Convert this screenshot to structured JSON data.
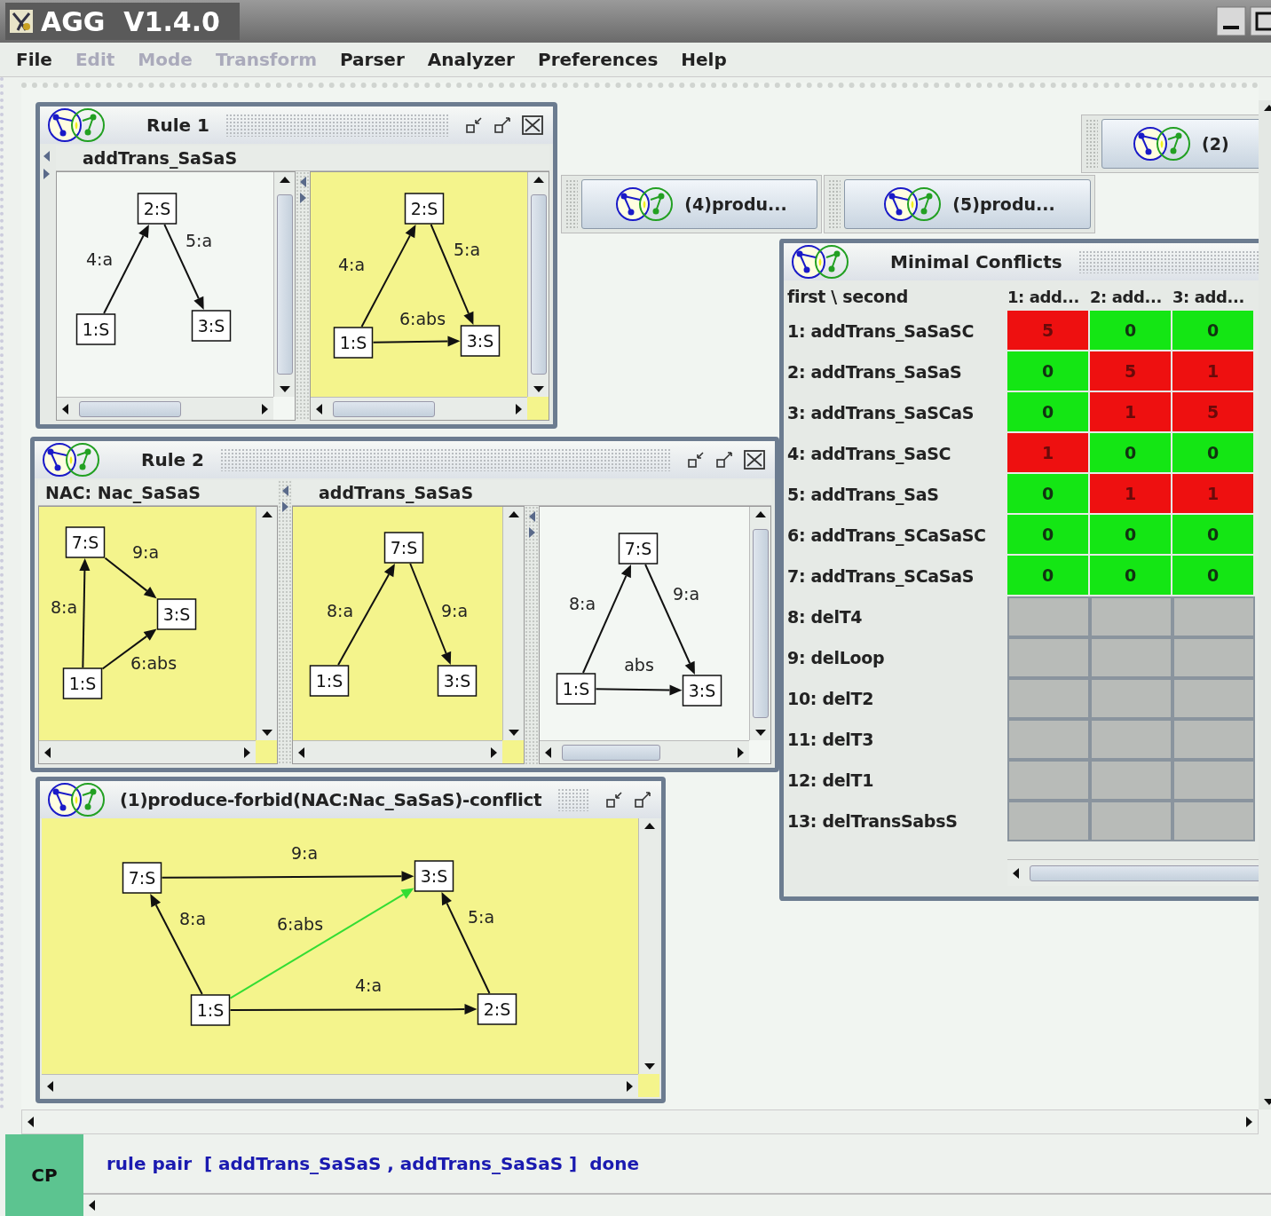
{
  "window": {
    "title": "AGG  V1.4.0"
  },
  "menu": [
    {
      "label": "File",
      "disabled": false
    },
    {
      "label": "Edit",
      "disabled": true
    },
    {
      "label": "Mode",
      "disabled": true
    },
    {
      "label": "Transform",
      "disabled": true
    },
    {
      "label": "Parser",
      "disabled": false
    },
    {
      "label": "Analyzer",
      "disabled": false
    },
    {
      "label": "Preferences",
      "disabled": false
    },
    {
      "label": "Help",
      "disabled": false
    }
  ],
  "iconified_frames": [
    {
      "label": "(2)"
    },
    {
      "label": "(4)produ..."
    },
    {
      "label": "(5)produ..."
    }
  ],
  "rule_frames": [
    {
      "title": "Rule 1",
      "sections": [
        {
          "header": "addTrans_SaSaS",
          "graphs": [
            {
              "selected": false,
              "nodes": [
                "2:S",
                "1:S",
                "3:S"
              ],
              "edges": [
                {
                  "label": "4:a"
                },
                {
                  "label": "5:a"
                }
              ]
            },
            {
              "selected": true,
              "nodes": [
                "2:S",
                "1:S",
                "3:S"
              ],
              "edges": [
                {
                  "label": "4:a"
                },
                {
                  "label": "5:a"
                },
                {
                  "label": "6:abs"
                }
              ]
            }
          ]
        }
      ]
    },
    {
      "title": "Rule 2",
      "sections": [
        {
          "header": "NAC: Nac_SaSaS",
          "graphs": [
            {
              "selected": true,
              "nodes": [
                "7:S",
                "3:S",
                "1:S"
              ],
              "edges": [
                {
                  "label": "9:a"
                },
                {
                  "label": "8:a"
                },
                {
                  "label": "6:abs"
                }
              ]
            }
          ]
        },
        {
          "header": "addTrans_SaSaS",
          "graphs": [
            {
              "selected": true,
              "nodes": [
                "7:S",
                "1:S",
                "3:S"
              ],
              "edges": [
                {
                  "label": "8:a"
                },
                {
                  "label": "9:a"
                }
              ]
            },
            {
              "selected": false,
              "nodes": [
                "7:S",
                "1:S",
                "3:S"
              ],
              "edges": [
                {
                  "label": "8:a"
                },
                {
                  "label": "9:a"
                },
                {
                  "label": "abs"
                }
              ]
            }
          ]
        }
      ]
    }
  ],
  "conflict_frame": {
    "title": "(1)produce-forbid(NAC:Nac_SaSaS)-conflict",
    "graph": {
      "selected": true,
      "nodes": [
        "7:S",
        "3:S",
        "1:S",
        "2:S"
      ],
      "edges": [
        {
          "label": "9:a",
          "highlighted": false
        },
        {
          "label": "8:a",
          "highlighted": false
        },
        {
          "label": "6:abs",
          "highlighted": true
        },
        {
          "label": "5:a",
          "highlighted": false
        },
        {
          "label": "4:a",
          "highlighted": false
        }
      ]
    }
  },
  "conflicts_table": {
    "title": "Minimal Conflicts",
    "corner": "first \\ second",
    "columns": [
      "1: add...",
      "2: add...",
      "3: add..."
    ],
    "rows": [
      {
        "name": "1: addTrans_SaSaSC",
        "cells": [
          {
            "value": "5",
            "conflict": true
          },
          {
            "value": "0",
            "conflict": false
          },
          {
            "value": "0",
            "conflict": false
          }
        ]
      },
      {
        "name": "2: addTrans_SaSaS",
        "cells": [
          {
            "value": "0",
            "conflict": false
          },
          {
            "value": "5",
            "conflict": true
          },
          {
            "value": "1",
            "conflict": true
          }
        ]
      },
      {
        "name": "3: addTrans_SaSCaS",
        "cells": [
          {
            "value": "0",
            "conflict": false
          },
          {
            "value": "1",
            "conflict": true
          },
          {
            "value": "5",
            "conflict": true
          }
        ]
      },
      {
        "name": "4: addTrans_SaSC",
        "cells": [
          {
            "value": "1",
            "conflict": true
          },
          {
            "value": "0",
            "conflict": false
          },
          {
            "value": "0",
            "conflict": false
          }
        ]
      },
      {
        "name": "5: addTrans_SaS",
        "cells": [
          {
            "value": "0",
            "conflict": false
          },
          {
            "value": "1",
            "conflict": true
          },
          {
            "value": "1",
            "conflict": true
          }
        ]
      },
      {
        "name": "6: addTrans_SCaSaSC",
        "cells": [
          {
            "value": "0",
            "conflict": false
          },
          {
            "value": "0",
            "conflict": false
          },
          {
            "value": "0",
            "conflict": false
          }
        ]
      },
      {
        "name": "7: addTrans_SCaSaS",
        "cells": [
          {
            "value": "0",
            "conflict": false
          },
          {
            "value": "0",
            "conflict": false
          },
          {
            "value": "0",
            "conflict": false
          }
        ]
      },
      {
        "name": "8: delT4"
      },
      {
        "name": "9: delLoop"
      },
      {
        "name": "10: delT2"
      },
      {
        "name": "11: delT3"
      },
      {
        "name": "12: delT1"
      },
      {
        "name": "13: delTransSabsS"
      }
    ]
  },
  "status_bar": {
    "badge": "CP",
    "message": "rule pair  [ addTrans_SaSaS , addTrans_SaSaS ]  done"
  }
}
